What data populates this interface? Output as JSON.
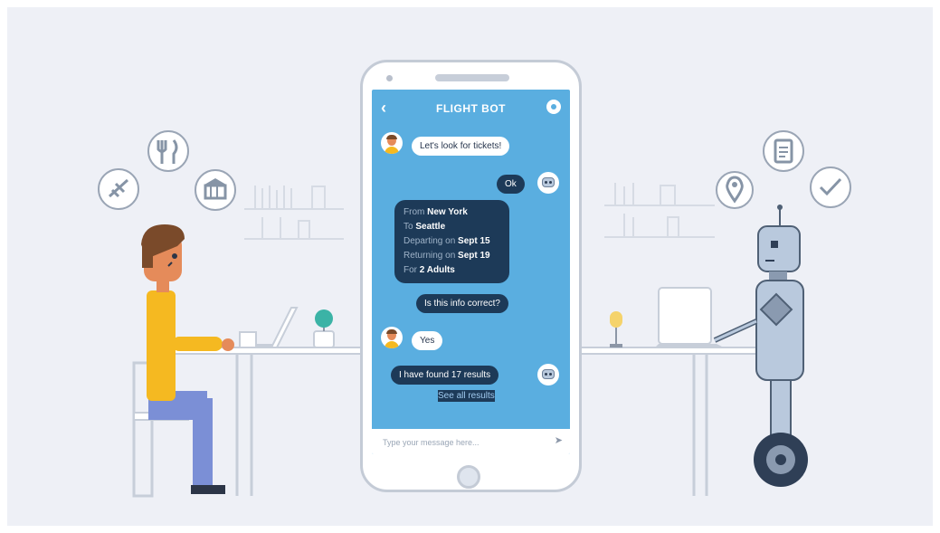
{
  "app": {
    "title": "FLIGHT BOT",
    "back_icon": "chevron-left-icon",
    "settings_icon": "gear-icon"
  },
  "chat": {
    "messages": [
      {
        "from": "user",
        "text": "Let's look for tickets!"
      },
      {
        "from": "bot",
        "text": "Ok"
      },
      {
        "from": "bot",
        "details": [
          {
            "label": "From",
            "value": "New York"
          },
          {
            "label": "To",
            "value": "Seattle"
          },
          {
            "label": "Departing on",
            "value": "Sept 15"
          },
          {
            "label": "Returning on",
            "value": "Sept 19"
          },
          {
            "label": "For",
            "value": "2 Adults"
          }
        ]
      },
      {
        "from": "bot",
        "text": "Is this info correct?"
      },
      {
        "from": "user",
        "text": "Yes"
      },
      {
        "from": "bot",
        "text": "I have found 17 results"
      },
      {
        "from": "bot",
        "text": "See all results",
        "type": "link"
      }
    ]
  },
  "input": {
    "placeholder": "Type your message here...",
    "send_icon": "send-arrow-icon"
  },
  "colors": {
    "screen": "#5aaee0",
    "bot_bubble": "#1d3a58",
    "user_bubble": "#ffffff",
    "shirt": "#f5b921",
    "pants": "#7b8fd6",
    "robot": "#b9c9dd"
  }
}
